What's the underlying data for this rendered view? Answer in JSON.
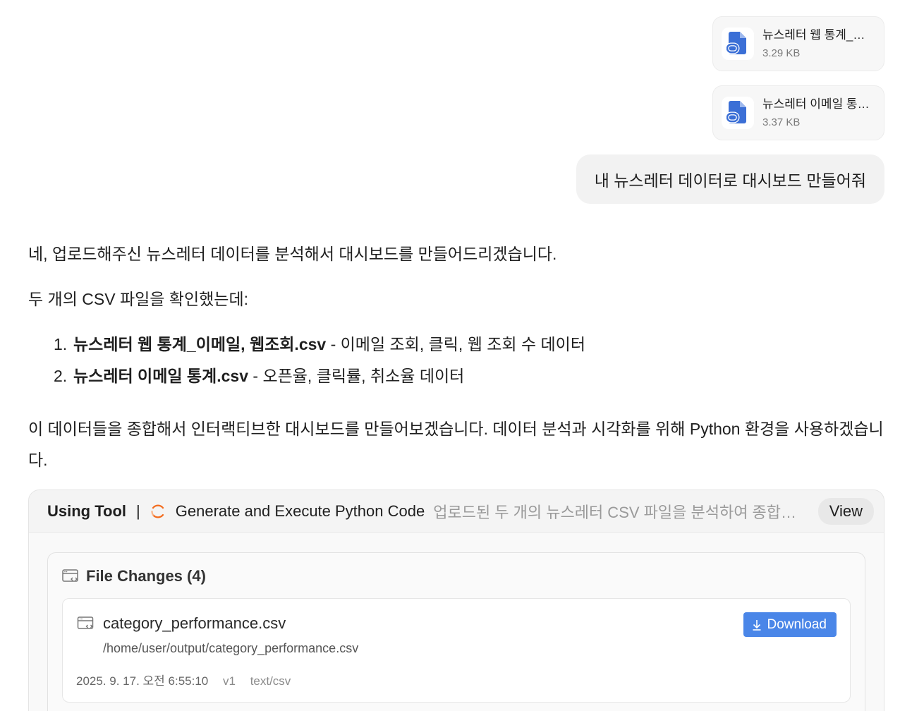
{
  "attachments": [
    {
      "name": "뉴스레터 웹 통계_이메일, 웹조회.csv",
      "size": "3.29 KB",
      "icon": "file-link-icon"
    },
    {
      "name": "뉴스레터 이메일 통계.csv",
      "size": "3.37 KB",
      "icon": "file-link-icon"
    }
  ],
  "user_message": "내 뉴스레터 데이터로 대시보드 만들어줘",
  "assistant": {
    "p1": "네, 업로드해주신 뉴스레터 데이터를 분석해서 대시보드를 만들어드리겠습니다.",
    "p2": "두 개의 CSV 파일을 확인했는데:",
    "list": [
      {
        "num": "1.",
        "bold": "뉴스레터 웹 통계_이메일, 웹조회.csv",
        "rest": " - 이메일 조회, 클릭, 웹 조회 수 데이터"
      },
      {
        "num": "2.",
        "bold": "뉴스레터 이메일 통계.csv",
        "rest": " - 오픈율, 클릭률, 취소율 데이터"
      }
    ],
    "p3": "이 데이터들을 종합해서 인터랙티브한 대시보드를 만들어보겠습니다. 데이터 분석과 시각화를 위해 Python 환경을 사용하겠습니다."
  },
  "tool": {
    "using_label": "Using Tool",
    "separator": "|",
    "name": "Generate and Execute Python Code",
    "description": "업로드된 두 개의 뉴스레터 CSV 파일을 분석하여 종합적인 대시보드를 만들기",
    "view_label": "View",
    "spinner_color": "#f26b1d",
    "file_changes_title": "File Changes (4)",
    "files": [
      {
        "name": "category_performance.csv",
        "path": "/home/user/output/category_performance.csv",
        "timestamp": "2025. 9. 17. 오전 6:55:10",
        "version": "v1",
        "mime": "text/csv",
        "download_label": "Download"
      }
    ]
  },
  "colors": {
    "accent": "#4a86e8",
    "file_icon": "#3b6fd6"
  }
}
